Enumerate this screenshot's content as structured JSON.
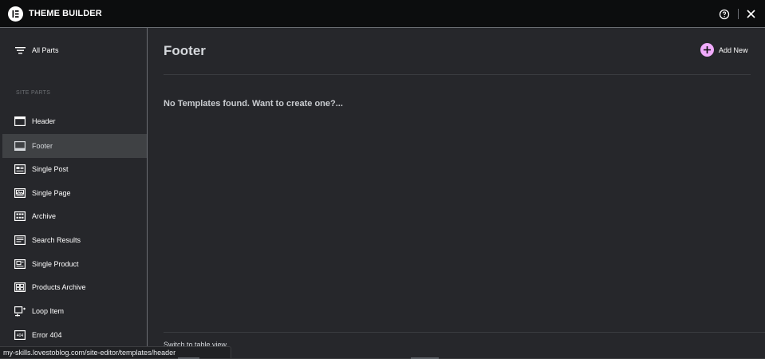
{
  "header": {
    "title": "THEME BUILDER",
    "logo_icon": "elementor-logo-icon",
    "help_icon": "help-circle-icon",
    "close_icon": "close-icon"
  },
  "sidebar": {
    "all_parts_label": "All Parts",
    "section_label": "SITE PARTS",
    "items": [
      {
        "label": "Header",
        "icon": "header-layout-icon",
        "active": false
      },
      {
        "label": "Footer",
        "icon": "footer-layout-icon",
        "active": true
      },
      {
        "label": "Single Post",
        "icon": "single-post-icon",
        "active": false
      },
      {
        "label": "Single Page",
        "icon": "single-page-icon",
        "active": false
      },
      {
        "label": "Archive",
        "icon": "archive-icon",
        "active": false
      },
      {
        "label": "Search Results",
        "icon": "search-results-icon",
        "active": false
      },
      {
        "label": "Single Product",
        "icon": "single-product-icon",
        "active": false
      },
      {
        "label": "Products Archive",
        "icon": "products-archive-icon",
        "active": false
      },
      {
        "label": "Loop Item",
        "icon": "loop-item-icon",
        "active": false
      },
      {
        "label": "Error 404",
        "icon": "error-404-icon",
        "active": false
      }
    ]
  },
  "main": {
    "title": "Footer",
    "add_new_label": "Add New",
    "empty_message": "No Templates found. Want to create one?...",
    "switch_view_label": "Switch to table view"
  },
  "status_bar": {
    "url": "my-skills.lovestoblog.com/site-editor/templates/header"
  },
  "colors": {
    "background": "#26272b",
    "topbar": "#0c0d0e",
    "active_item": "#3f4144",
    "accent_pink": "#f0abfc"
  }
}
